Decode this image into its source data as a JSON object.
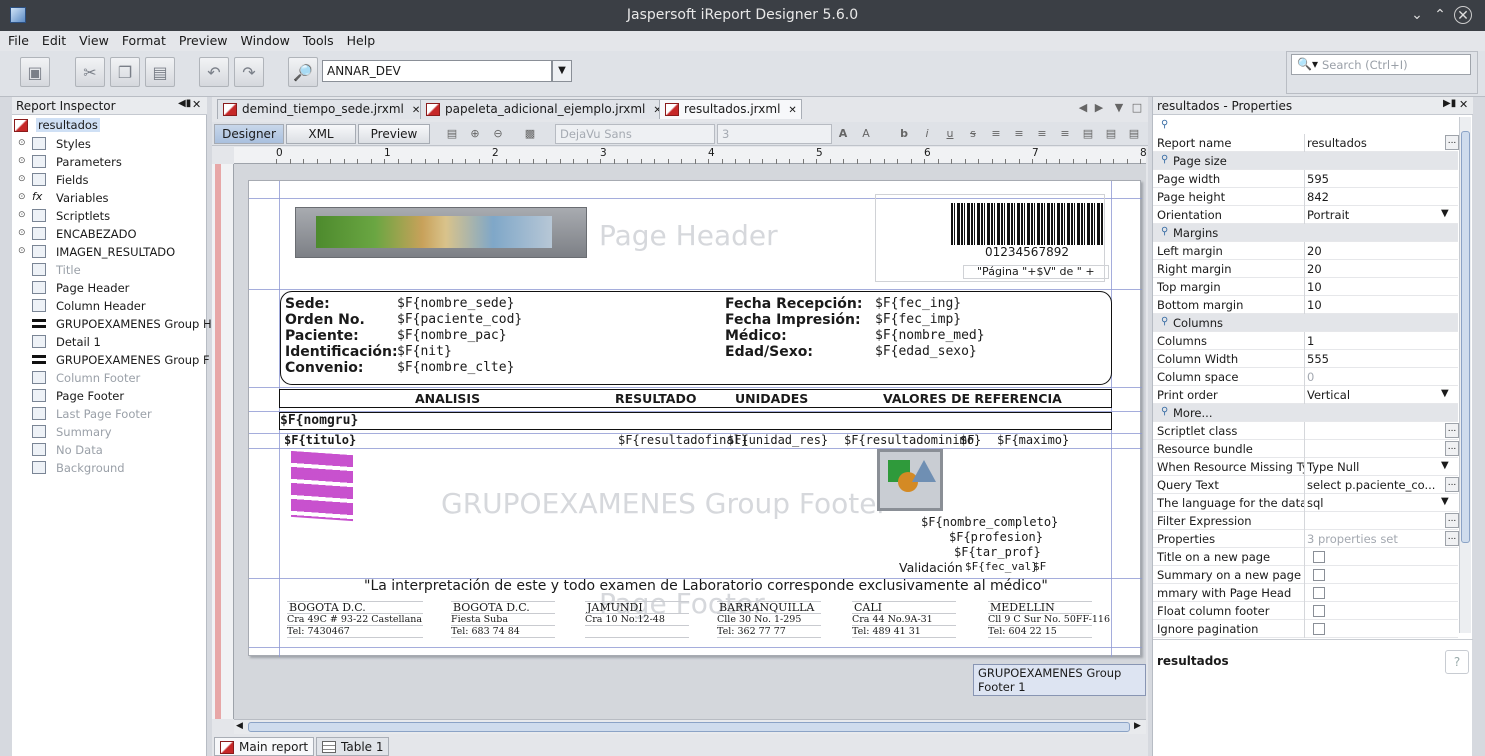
{
  "window": {
    "title": "Jaspersoft iReport Designer 5.6.0",
    "controls": [
      "chevron-down-icon",
      "chevron-up-icon",
      "close-icon"
    ]
  },
  "menu": [
    "File",
    "Edit",
    "View",
    "Format",
    "Preview",
    "Window",
    "Tools",
    "Help"
  ],
  "toolbar": {
    "datasource": "ANNAR_DEV",
    "search_placeholder": "Search (Ctrl+I)"
  },
  "inspector": {
    "title": "Report Inspector",
    "root": "resultados",
    "items": [
      {
        "label": "Styles",
        "dim": false
      },
      {
        "label": "Parameters",
        "dim": false
      },
      {
        "label": "Fields",
        "dim": false
      },
      {
        "label": "Variables",
        "dim": false
      },
      {
        "label": "Scriptlets",
        "dim": false
      },
      {
        "label": "ENCABEZADO",
        "dim": false
      },
      {
        "label": "IMAGEN_RESULTADO",
        "dim": false
      },
      {
        "label": "Title",
        "dim": true
      },
      {
        "label": "Page Header",
        "dim": false
      },
      {
        "label": "Column Header",
        "dim": false
      },
      {
        "label": "GRUPOEXAMENES Group H",
        "dim": false
      },
      {
        "label": "Detail 1",
        "dim": false
      },
      {
        "label": "GRUPOEXAMENES Group F",
        "dim": false
      },
      {
        "label": "Column Footer",
        "dim": true
      },
      {
        "label": "Page Footer",
        "dim": false
      },
      {
        "label": "Last Page Footer",
        "dim": true
      },
      {
        "label": "Summary",
        "dim": true
      },
      {
        "label": "No Data",
        "dim": true
      },
      {
        "label": "Background",
        "dim": true
      }
    ]
  },
  "tabs": [
    {
      "label": "demind_tiempo_sede.jrxml"
    },
    {
      "label": "papeleta_adicional_ejemplo.jrxml"
    },
    {
      "label": "resultados.jrxml"
    }
  ],
  "editor": {
    "modes": [
      "Designer",
      "XML",
      "Preview"
    ],
    "font": "DejaVu Sans",
    "size": "3",
    "ruler": [
      "0",
      "1",
      "2",
      "3",
      "4",
      "5",
      "6",
      "7",
      "8"
    ]
  },
  "report": {
    "page_header_band": "Page Header",
    "barcode_text": "01234567892",
    "page_expr": "\"Página \"+$V\" de \" +",
    "labels_left": [
      "Sede:",
      "Orden No.",
      "Paciente:",
      "Identificación:",
      "Convenio:"
    ],
    "fields_left": [
      "$F{nombre_sede}",
      "$F{paciente_cod}",
      "$F{nombre_pac}",
      "$F{nit}",
      "$F{nombre_clte}"
    ],
    "labels_right": [
      "Fecha Recepción:",
      "Fecha Impresión:",
      "Médico:",
      "Edad/Sexo:"
    ],
    "fields_right": [
      "$F{fec_ing}",
      "$F{fec_imp}",
      "$F{nombre_med}",
      "$F{edad_sexo}"
    ],
    "col_headers": [
      "ANALISIS",
      "RESULTADO",
      "UNIDADES",
      "VALORES DE REFERENCIA"
    ],
    "nomgru": "$F{nomgru}",
    "detail": {
      "titulo": "$F{titulo}",
      "resultado": "$F{resultadofinal}",
      "unidad": "$F{unidad_res}",
      "minimo": "$F{resultadominimo}",
      "maximo": "$F{maximo}",
      "f": "$F"
    },
    "group_footer_band": "GRUPOEXAMENES Group Footer",
    "footer_fields": [
      "$F{nombre_completo}",
      "$F{profesion}",
      "$F{tar_prof}"
    ],
    "validacion_label": "Validación",
    "validacion_field": "$F{fec_val}",
    "validacion_extra": "$F",
    "interpretacion": "\"La interpretación de este y todo examen de Laboratorio corresponde exclusivamente al médico\"",
    "page_footer_band": "Page Footer",
    "sedes": [
      {
        "city": "BOGOTA D.C.",
        "addr": "Cra 49C # 93-22 Castellana",
        "tel": "Tel: 7430467"
      },
      {
        "city": "BOGOTA D.C.",
        "addr": "Fiesta Suba",
        "tel": "Tel: 683 74 84"
      },
      {
        "city": "JAMUNDI",
        "addr": "Cra 10 No.12-48",
        "tel": ""
      },
      {
        "city": "BARRANQUILLA",
        "addr": "Clle 30 No. 1-295",
        "tel": "Tel: 362 77 77"
      },
      {
        "city": "CALI",
        "addr": "Cra 44 No.9A-31",
        "tel": "Tel: 489 41 31"
      },
      {
        "city": "MEDELLIN",
        "addr": "Cll 9 C Sur No. 50FF-116",
        "tel": "Tel: 604 22 15"
      }
    ],
    "tooltip": "GRUPOEXAMENES Group Footer 1"
  },
  "bottom_tabs": [
    "Main report",
    "Table 1"
  ],
  "properties": {
    "title": "resultados - Properties",
    "rows": [
      {
        "k": "Report name",
        "v": "resultados",
        "type": "ell"
      },
      {
        "k": "Page size",
        "type": "sec"
      },
      {
        "k": "Page width",
        "v": "595"
      },
      {
        "k": "Page height",
        "v": "842"
      },
      {
        "k": "Orientation",
        "v": "Portrait",
        "type": "dd"
      },
      {
        "k": "Margins",
        "type": "sec"
      },
      {
        "k": "Left margin",
        "v": "20"
      },
      {
        "k": "Right margin",
        "v": "20"
      },
      {
        "k": "Top margin",
        "v": "10"
      },
      {
        "k": "Bottom margin",
        "v": "10"
      },
      {
        "k": "Columns",
        "type": "sec"
      },
      {
        "k": "Columns",
        "v": "1"
      },
      {
        "k": "Column Width",
        "v": "555"
      },
      {
        "k": "Column space",
        "v": "0",
        "gray": true
      },
      {
        "k": "Print order",
        "v": "Vertical",
        "type": "dd"
      },
      {
        "k": "More...",
        "type": "sec"
      },
      {
        "k": "Scriptlet class",
        "v": "",
        "type": "ell"
      },
      {
        "k": "Resource bundle",
        "v": "",
        "type": "ell"
      },
      {
        "k": "When Resource Missing Ty",
        "v": "Type Null",
        "type": "dd"
      },
      {
        "k": "Query Text",
        "v": "select p.paciente_co...",
        "type": "ell"
      },
      {
        "k": "The language for the data",
        "v": "sql",
        "type": "dd"
      },
      {
        "k": "Filter Expression",
        "v": "",
        "type": "ell"
      },
      {
        "k": "Properties",
        "v": "3 properties set",
        "type": "ell",
        "gray": true
      },
      {
        "k": "Title on a new page",
        "type": "chk"
      },
      {
        "k": "Summary on a new page",
        "type": "chk"
      },
      {
        "k": "mmary with Page Head",
        "type": "chk"
      },
      {
        "k": "Float column footer",
        "type": "chk"
      },
      {
        "k": "Ignore pagination",
        "type": "chk"
      }
    ],
    "footer_name": "resultados"
  }
}
